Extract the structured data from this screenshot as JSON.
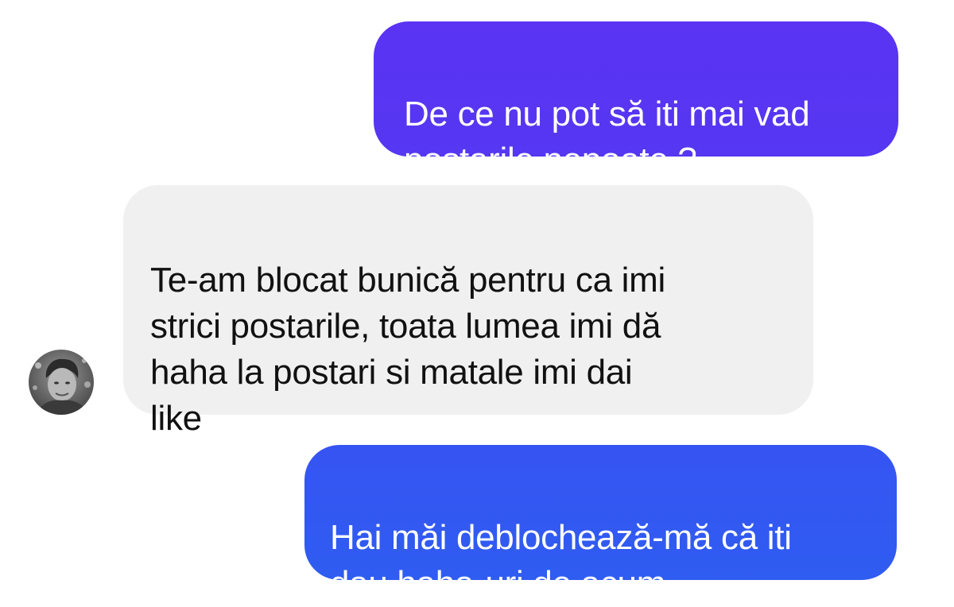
{
  "conversation": {
    "messages": [
      {
        "sender": "me",
        "text": "De ce nu pot să iti mai vad\npostarile nepoate ?"
      },
      {
        "sender": "contact",
        "text": "Te-am blocat bunică pentru ca imi\nstrici postarile, toata lumea imi dă\nhaha la postari si matale imi dai\nlike"
      },
      {
        "sender": "me",
        "text": "Hai măi deblochează-mă că iti\ndau haha-uri de acum"
      }
    ],
    "contact": {
      "avatar_icon": "contact-avatar-photo"
    }
  },
  "colors": {
    "outgoing_bubble_top": "#5b34f4",
    "outgoing_bubble_bottom": "#3056f2",
    "incoming_bubble": "#f1f0f0",
    "outgoing_text": "#ffffff",
    "incoming_text": "#111111"
  }
}
